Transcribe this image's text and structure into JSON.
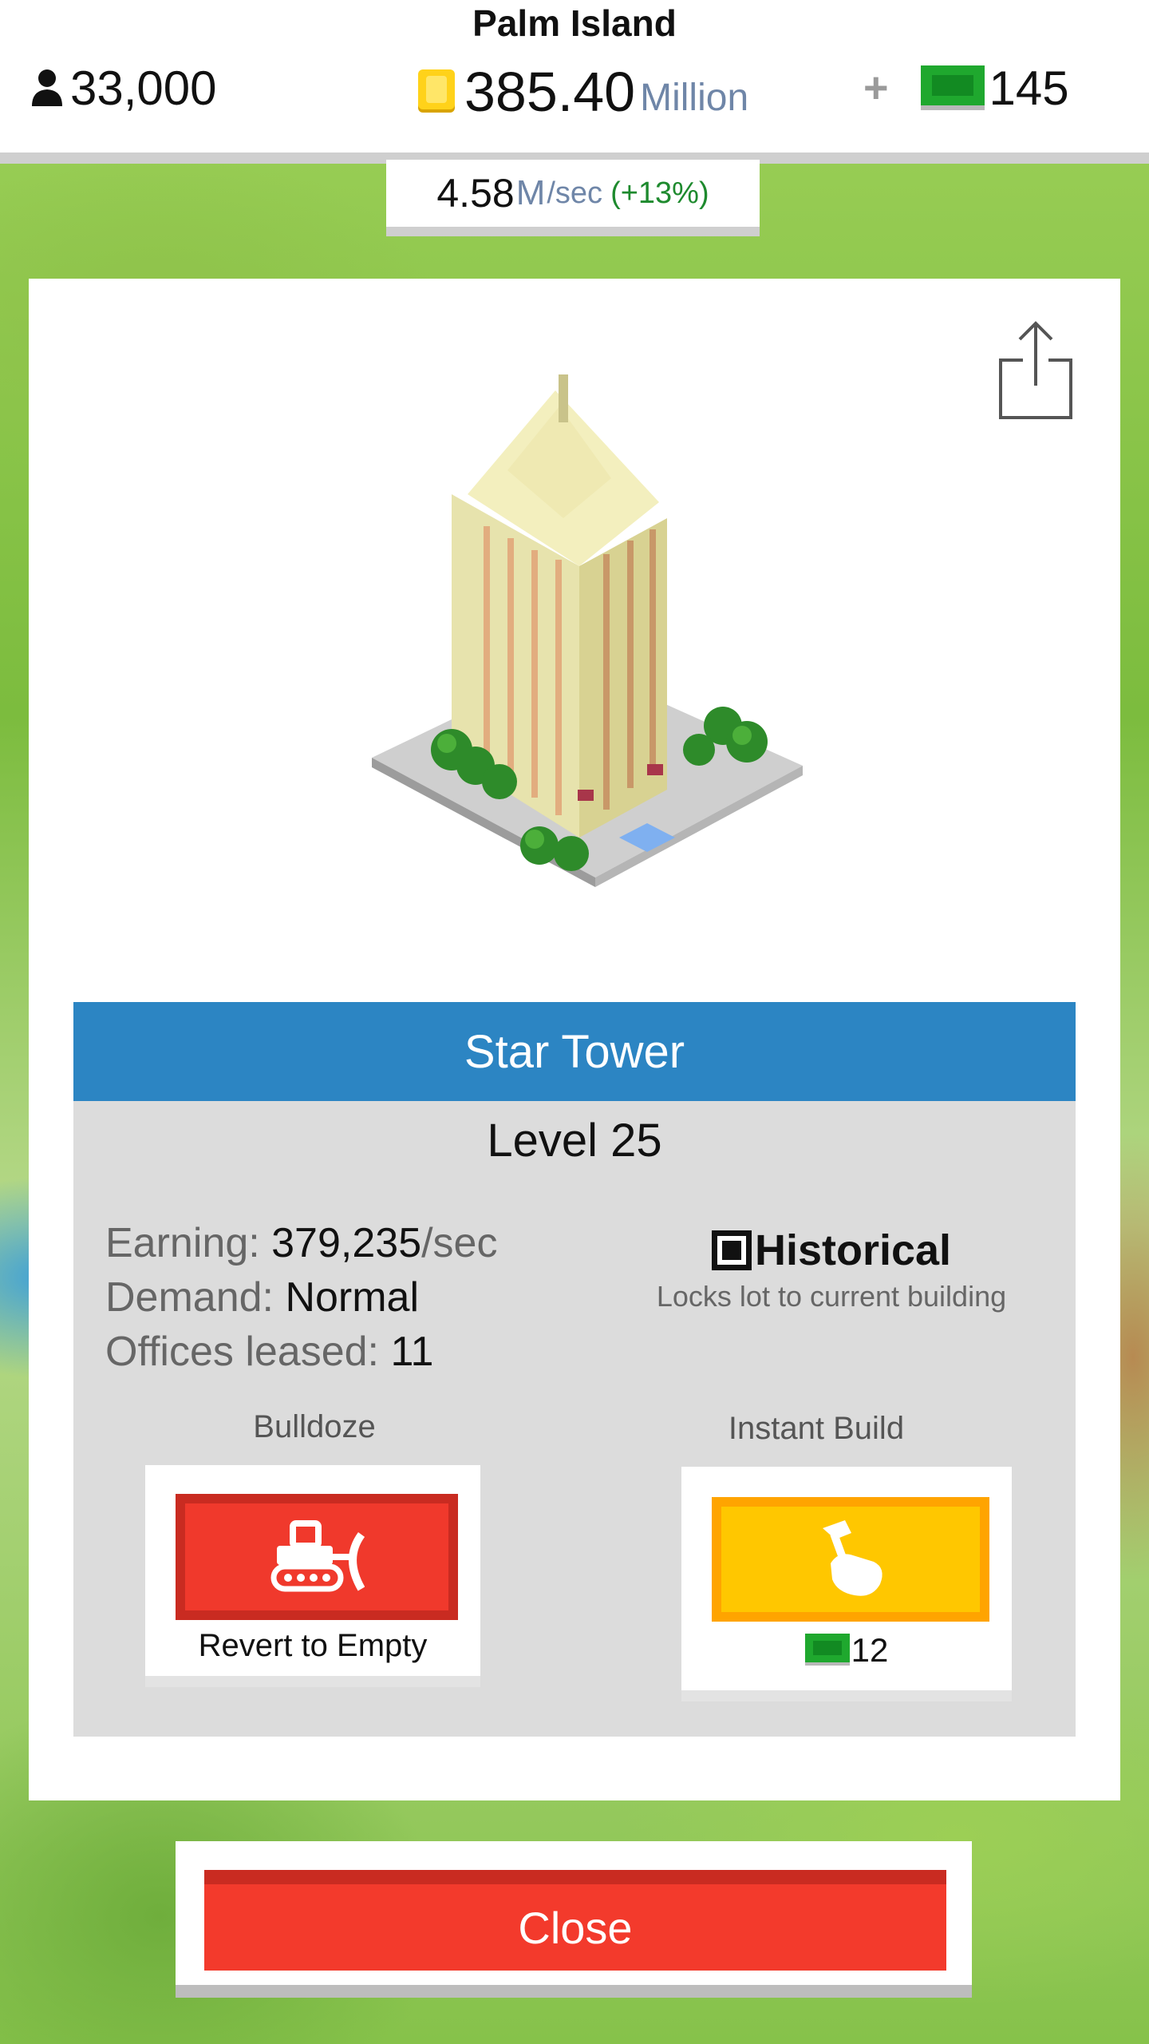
{
  "header": {
    "island_name": "Palm Island",
    "population": "33,000",
    "population_icon": "person-icon",
    "money_value": "385.40",
    "money_unit": "Million",
    "money_icon": "coin-icon",
    "plus_label": "+",
    "bux_value": "145",
    "bux_icon": "bux-icon"
  },
  "rate": {
    "value": "4.58",
    "unit": "M",
    "per": "/sec",
    "change": "(+13%)"
  },
  "building": {
    "name": "Star Tower",
    "level": "Level 25",
    "image_icon": "voxel-skyscraper-image",
    "share_icon": "share-icon",
    "stats": {
      "earning_label": "Earning:",
      "earning_value": "379,235",
      "earning_suffix": "/sec",
      "demand_label": "Demand:",
      "demand_value": "Normal",
      "offices_label": "Offices leased:",
      "offices_value": "11"
    },
    "historical": {
      "label": "Historical",
      "description": "Locks lot to current building",
      "checked": true
    }
  },
  "actions": {
    "bulldoze_title": "Bulldoze",
    "bulldoze_caption": "Revert to Empty",
    "bulldoze_icon": "bulldozer-icon",
    "instant_build_title": "Instant Build",
    "instant_build_cost": "12",
    "instant_build_icon": "hammer-hand-icon"
  },
  "close_label": "Close",
  "colors": {
    "header_blue": "#2c85c3",
    "close_red": "#f33a2c",
    "bulldoze_red": "#f0392c",
    "build_yellow": "#ffc700",
    "bux_green": "#1fa82e",
    "coin_gold": "#ffd21a",
    "rate_green": "#1e8a2e",
    "unit_blue_gray": "#6f86a8"
  }
}
